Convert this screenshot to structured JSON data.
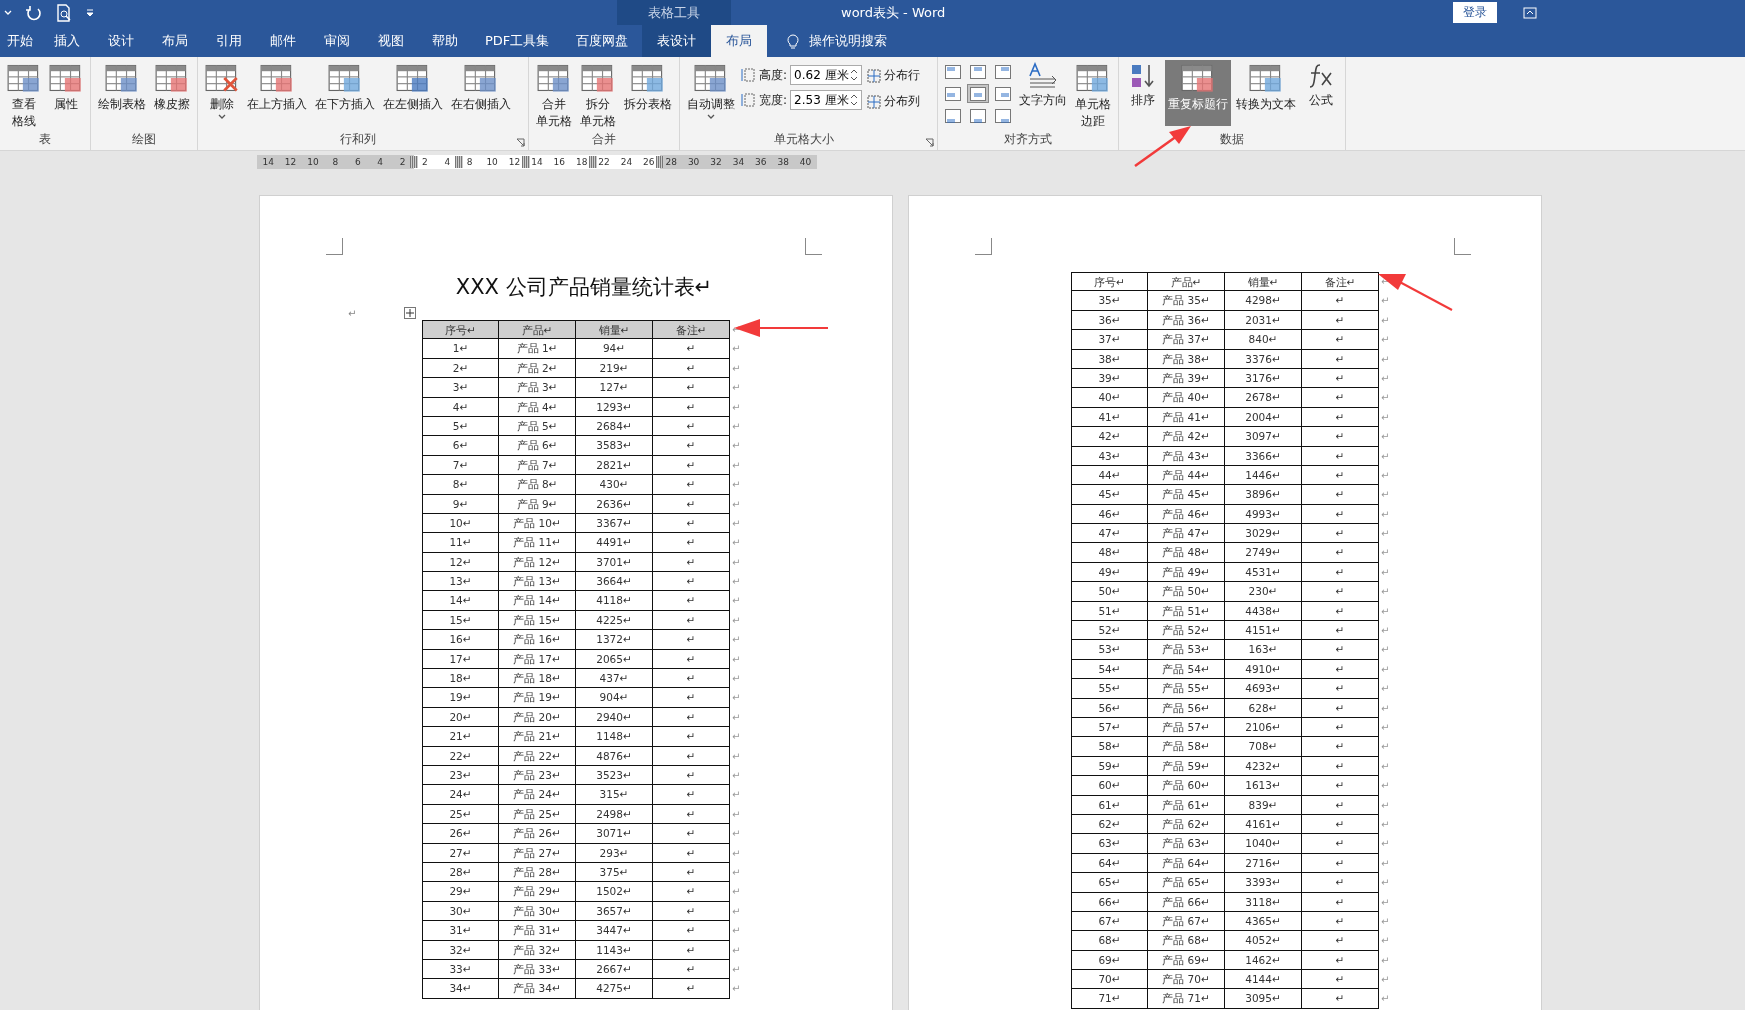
{
  "title_bar": {
    "context_label": "表格工具",
    "title": "word表头  -  Word",
    "login": "登录"
  },
  "tabs": [
    {
      "label": "开始",
      "selected": false,
      "contextual": false
    },
    {
      "label": "插入",
      "selected": false,
      "contextual": false
    },
    {
      "label": "设计",
      "selected": false,
      "contextual": false
    },
    {
      "label": "布局",
      "selected": false,
      "contextual": false
    },
    {
      "label": "引用",
      "selected": false,
      "contextual": false
    },
    {
      "label": "邮件",
      "selected": false,
      "contextual": false
    },
    {
      "label": "审阅",
      "selected": false,
      "contextual": false
    },
    {
      "label": "视图",
      "selected": false,
      "contextual": false
    },
    {
      "label": "帮助",
      "selected": false,
      "contextual": false
    },
    {
      "label": "PDF工具集",
      "selected": false,
      "contextual": false
    },
    {
      "label": "百度网盘",
      "selected": false,
      "contextual": false
    },
    {
      "label": "表设计",
      "selected": false,
      "contextual": true
    },
    {
      "label": "布局",
      "selected": true,
      "contextual": true
    }
  ],
  "tell_me": "操作说明搜索",
  "ribbon": [
    {
      "label": "表",
      "launcher": false,
      "items": [
        {
          "kind": "large",
          "lines": [
            "查看",
            "格线"
          ],
          "pressed": false,
          "dropdown": false
        },
        {
          "kind": "large",
          "lines": [
            "属性"
          ],
          "pressed": false,
          "dropdown": false
        }
      ]
    },
    {
      "label": "绘图",
      "launcher": false,
      "items": [
        {
          "kind": "large",
          "lines": [
            "绘制表格"
          ],
          "pressed": false,
          "dropdown": false
        },
        {
          "kind": "large",
          "lines": [
            "橡皮擦"
          ],
          "pressed": false,
          "dropdown": false
        }
      ]
    },
    {
      "label": "行和列",
      "launcher": true,
      "items": [
        {
          "kind": "large",
          "lines": [
            "删除"
          ],
          "pressed": false,
          "dropdown": true
        },
        {
          "kind": "large",
          "lines": [
            "在上方插入"
          ],
          "pressed": false,
          "dropdown": false
        },
        {
          "kind": "large",
          "lines": [
            "在下方插入"
          ],
          "pressed": false,
          "dropdown": false
        },
        {
          "kind": "large",
          "lines": [
            "在左侧插入"
          ],
          "pressed": false,
          "dropdown": false
        },
        {
          "kind": "large",
          "lines": [
            "在右侧插入"
          ],
          "pressed": false,
          "dropdown": false
        }
      ]
    },
    {
      "label": "合并",
      "launcher": false,
      "items": [
        {
          "kind": "large",
          "lines": [
            "合并",
            "单元格"
          ],
          "pressed": false,
          "dropdown": false
        },
        {
          "kind": "large",
          "lines": [
            "拆分",
            "单元格"
          ],
          "pressed": false,
          "dropdown": false
        },
        {
          "kind": "large",
          "lines": [
            "拆分表格"
          ],
          "pressed": false,
          "dropdown": false
        }
      ]
    },
    {
      "label": "单元格大小",
      "launcher": true,
      "items": [
        {
          "kind": "large",
          "lines": [
            "自动调整"
          ],
          "pressed": false,
          "dropdown": true
        },
        {
          "kind": "fields",
          "fields": [
            {
              "label": "高度:",
              "value": "0.62 厘米"
            },
            {
              "label": "宽度:",
              "value": "2.53 厘米"
            }
          ]
        },
        {
          "kind": "smalls",
          "buttons": [
            {
              "label": "分布行"
            },
            {
              "label": "分布列"
            }
          ]
        }
      ]
    },
    {
      "label": "对齐方式",
      "launcher": false,
      "items": [
        {
          "kind": "align",
          "cells": [
            {
              "selected": false
            },
            {
              "selected": false
            },
            {
              "selected": false
            },
            {
              "selected": false
            },
            {
              "selected": true
            },
            {
              "selected": false
            },
            {
              "selected": false
            },
            {
              "selected": false
            },
            {
              "selected": false
            }
          ]
        },
        {
          "kind": "large",
          "lines": [
            "文字方向"
          ],
          "pressed": false,
          "dropdown": false
        },
        {
          "kind": "large",
          "lines": [
            "单元格",
            "边距"
          ],
          "pressed": false,
          "dropdown": false
        }
      ]
    },
    {
      "label": "数据",
      "launcher": false,
      "items": [
        {
          "kind": "large",
          "lines": [
            "排序"
          ],
          "pressed": false,
          "dropdown": false
        },
        {
          "kind": "large",
          "lines": [
            "重复标题行"
          ],
          "pressed": true,
          "dropdown": false
        },
        {
          "kind": "large",
          "lines": [
            "转换为文本"
          ],
          "pressed": false,
          "dropdown": false
        },
        {
          "kind": "large",
          "lines": [
            "公式"
          ],
          "pressed": false,
          "dropdown": false
        }
      ]
    }
  ],
  "ruler": [
    {
      "kind": "margin",
      "label": "14"
    },
    {
      "kind": "margin",
      "label": "12"
    },
    {
      "kind": "margin",
      "label": "10"
    },
    {
      "kind": "margin",
      "label": "8"
    },
    {
      "kind": "margin",
      "label": "6"
    },
    {
      "kind": "margin",
      "label": "4"
    },
    {
      "kind": "margin",
      "label": "2"
    },
    {
      "kind": "marker"
    },
    {
      "kind": "text",
      "label": "2"
    },
    {
      "kind": "text",
      "label": "4"
    },
    {
      "kind": "marker"
    },
    {
      "kind": "text",
      "label": "8"
    },
    {
      "kind": "text",
      "label": "10"
    },
    {
      "kind": "text",
      "label": "12"
    },
    {
      "kind": "marker"
    },
    {
      "kind": "text",
      "label": "14"
    },
    {
      "kind": "text",
      "label": "16"
    },
    {
      "kind": "text",
      "label": "18"
    },
    {
      "kind": "marker"
    },
    {
      "kind": "text",
      "label": "22"
    },
    {
      "kind": "text",
      "label": "24"
    },
    {
      "kind": "text",
      "label": "26"
    },
    {
      "kind": "marker"
    },
    {
      "kind": "margin",
      "label": "28"
    },
    {
      "kind": "margin",
      "label": "30"
    },
    {
      "kind": "margin",
      "label": "32"
    },
    {
      "kind": "margin",
      "label": "34"
    },
    {
      "kind": "margin",
      "label": "36"
    },
    {
      "kind": "margin",
      "label": "38"
    },
    {
      "kind": "margin",
      "label": "40"
    }
  ],
  "pages": [
    {
      "title": "XXX 公司产品销量统计表↵",
      "lead_mark": "↵",
      "header": {
        "selected": true,
        "cells": [
          "序号↵",
          "产品↵",
          "销量↵",
          "备注↵",
          "↵"
        ]
      },
      "rows": [
        [
          "1↵",
          "产品 1↵",
          "94↵",
          "↵",
          "↵"
        ],
        [
          "2↵",
          "产品 2↵",
          "219↵",
          "↵",
          "↵"
        ],
        [
          "3↵",
          "产品 3↵",
          "127↵",
          "↵",
          "↵"
        ],
        [
          "4↵",
          "产品 4↵",
          "1293↵",
          "↵",
          "↵"
        ],
        [
          "5↵",
          "产品 5↵",
          "2684↵",
          "↵",
          "↵"
        ],
        [
          "6↵",
          "产品 6↵",
          "3583↵",
          "↵",
          "↵"
        ],
        [
          "7↵",
          "产品 7↵",
          "2821↵",
          "↵",
          "↵"
        ],
        [
          "8↵",
          "产品 8↵",
          "430↵",
          "↵",
          "↵"
        ],
        [
          "9↵",
          "产品 9↵",
          "2636↵",
          "↵",
          "↵"
        ],
        [
          "10↵",
          "产品 10↵",
          "3367↵",
          "↵",
          "↵"
        ],
        [
          "11↵",
          "产品 11↵",
          "4491↵",
          "↵",
          "↵"
        ],
        [
          "12↵",
          "产品 12↵",
          "3701↵",
          "↵",
          "↵"
        ],
        [
          "13↵",
          "产品 13↵",
          "3664↵",
          "↵",
          "↵"
        ],
        [
          "14↵",
          "产品 14↵",
          "4118↵",
          "↵",
          "↵"
        ],
        [
          "15↵",
          "产品 15↵",
          "4225↵",
          "↵",
          "↵"
        ],
        [
          "16↵",
          "产品 16↵",
          "1372↵",
          "↵",
          "↵"
        ],
        [
          "17↵",
          "产品 17↵",
          "2065↵",
          "↵",
          "↵"
        ],
        [
          "18↵",
          "产品 18↵",
          "437↵",
          "↵",
          "↵"
        ],
        [
          "19↵",
          "产品 19↵",
          "904↵",
          "↵",
          "↵"
        ],
        [
          "20↵",
          "产品 20↵",
          "2940↵",
          "↵",
          "↵"
        ],
        [
          "21↵",
          "产品 21↵",
          "1148↵",
          "↵",
          "↵"
        ],
        [
          "22↵",
          "产品 22↵",
          "4876↵",
          "↵",
          "↵"
        ],
        [
          "23↵",
          "产品 23↵",
          "3523↵",
          "↵",
          "↵"
        ],
        [
          "24↵",
          "产品 24↵",
          "315↵",
          "↵",
          "↵"
        ],
        [
          "25↵",
          "产品 25↵",
          "2498↵",
          "↵",
          "↵"
        ],
        [
          "26↵",
          "产品 26↵",
          "3071↵",
          "↵",
          "↵"
        ],
        [
          "27↵",
          "产品 27↵",
          "293↵",
          "↵",
          "↵"
        ],
        [
          "28↵",
          "产品 28↵",
          "375↵",
          "↵",
          "↵"
        ],
        [
          "29↵",
          "产品 29↵",
          "1502↵",
          "↵",
          "↵"
        ],
        [
          "30↵",
          "产品 30↵",
          "3657↵",
          "↵",
          "↵"
        ],
        [
          "31↵",
          "产品 31↵",
          "3447↵",
          "↵",
          "↵"
        ],
        [
          "32↵",
          "产品 32↵",
          "1143↵",
          "↵",
          "↵"
        ],
        [
          "33↵",
          "产品 33↵",
          "2667↵",
          "↵",
          "↵"
        ],
        [
          "34↵",
          "产品 34↵",
          "4275↵",
          "↵",
          "↵"
        ]
      ]
    },
    {
      "header": {
        "selected": false,
        "cells": [
          "序号↵",
          "产品↵",
          "销量↵",
          "备注↵",
          "↵"
        ]
      },
      "rows": [
        [
          "35↵",
          "产品 35↵",
          "4298↵",
          "↵",
          "↵"
        ],
        [
          "36↵",
          "产品 36↵",
          "2031↵",
          "↵",
          "↵"
        ],
        [
          "37↵",
          "产品 37↵",
          "840↵",
          "↵",
          "↵"
        ],
        [
          "38↵",
          "产品 38↵",
          "3376↵",
          "↵",
          "↵"
        ],
        [
          "39↵",
          "产品 39↵",
          "3176↵",
          "↵",
          "↵"
        ],
        [
          "40↵",
          "产品 40↵",
          "2678↵",
          "↵",
          "↵"
        ],
        [
          "41↵",
          "产品 41↵",
          "2004↵",
          "↵",
          "↵"
        ],
        [
          "42↵",
          "产品 42↵",
          "3097↵",
          "↵",
          "↵"
        ],
        [
          "43↵",
          "产品 43↵",
          "3366↵",
          "↵",
          "↵"
        ],
        [
          "44↵",
          "产品 44↵",
          "1446↵",
          "↵",
          "↵"
        ],
        [
          "45↵",
          "产品 45↵",
          "3896↵",
          "↵",
          "↵"
        ],
        [
          "46↵",
          "产品 46↵",
          "4993↵",
          "↵",
          "↵"
        ],
        [
          "47↵",
          "产品 47↵",
          "3029↵",
          "↵",
          "↵"
        ],
        [
          "48↵",
          "产品 48↵",
          "2749↵",
          "↵",
          "↵"
        ],
        [
          "49↵",
          "产品 49↵",
          "4531↵",
          "↵",
          "↵"
        ],
        [
          "50↵",
          "产品 50↵",
          "230↵",
          "↵",
          "↵"
        ],
        [
          "51↵",
          "产品 51↵",
          "4438↵",
          "↵",
          "↵"
        ],
        [
          "52↵",
          "产品 52↵",
          "4151↵",
          "↵",
          "↵"
        ],
        [
          "53↵",
          "产品 53↵",
          "163↵",
          "↵",
          "↵"
        ],
        [
          "54↵",
          "产品 54↵",
          "4910↵",
          "↵",
          "↵"
        ],
        [
          "55↵",
          "产品 55↵",
          "4693↵",
          "↵",
          "↵"
        ],
        [
          "56↵",
          "产品 56↵",
          "628↵",
          "↵",
          "↵"
        ],
        [
          "57↵",
          "产品 57↵",
          "2106↵",
          "↵",
          "↵"
        ],
        [
          "58↵",
          "产品 58↵",
          "708↵",
          "↵",
          "↵"
        ],
        [
          "59↵",
          "产品 59↵",
          "4232↵",
          "↵",
          "↵"
        ],
        [
          "60↵",
          "产品 60↵",
          "1613↵",
          "↵",
          "↵"
        ],
        [
          "61↵",
          "产品 61↵",
          "839↵",
          "↵",
          "↵"
        ],
        [
          "62↵",
          "产品 62↵",
          "4161↵",
          "↵",
          "↵"
        ],
        [
          "63↵",
          "产品 63↵",
          "1040↵",
          "↵",
          "↵"
        ],
        [
          "64↵",
          "产品 64↵",
          "2716↵",
          "↵",
          "↵"
        ],
        [
          "65↵",
          "产品 65↵",
          "3393↵",
          "↵",
          "↵"
        ],
        [
          "66↵",
          "产品 66↵",
          "3118↵",
          "↵",
          "↵"
        ],
        [
          "67↵",
          "产品 67↵",
          "4365↵",
          "↵",
          "↵"
        ],
        [
          "68↵",
          "产品 68↵",
          "4052↵",
          "↵",
          "↵"
        ],
        [
          "69↵",
          "产品 69↵",
          "1462↵",
          "↵",
          "↵"
        ],
        [
          "70↵",
          "产品 70↵",
          "4144↵",
          "↵",
          "↵"
        ],
        [
          "71↵",
          "产品 71↵",
          "3095↵",
          "↵",
          "↵"
        ]
      ]
    }
  ]
}
